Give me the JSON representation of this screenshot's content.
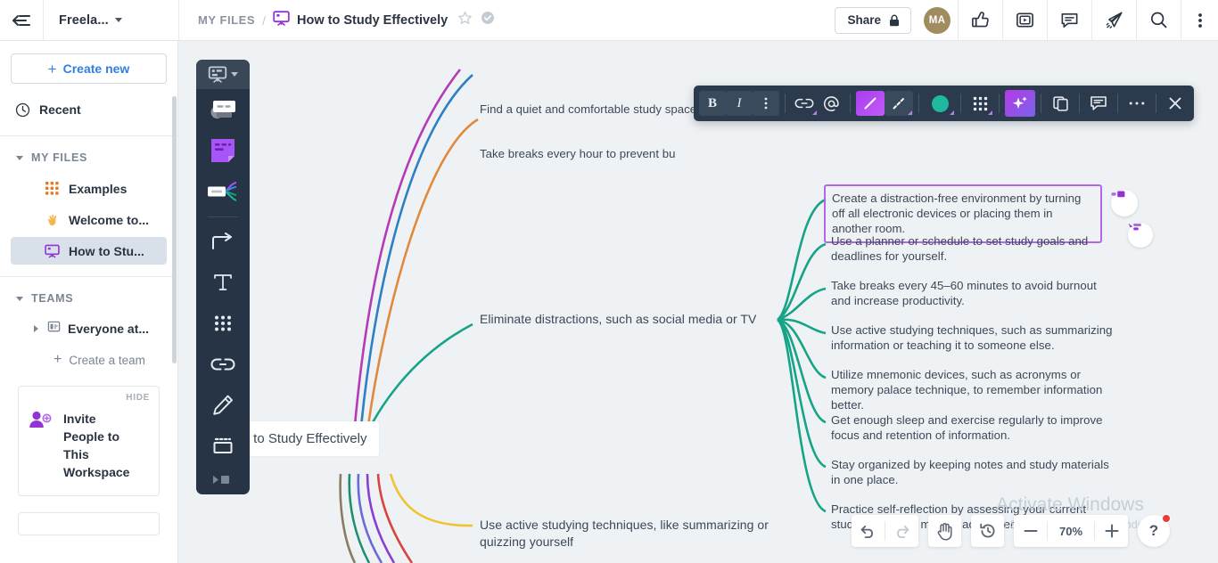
{
  "topbar": {
    "collapse_icon": "collapse-sidebar-icon",
    "workspace_name": "Freela...",
    "breadcrumb_root": "MY FILES",
    "breadcrumb_sep": "/",
    "board_title": "How to Study Effectively",
    "share_label": "Share",
    "avatar_initials": "MA",
    "icons": [
      "thumbs-up-icon",
      "presentation-play-icon",
      "comment-icon",
      "paper-plane-icon",
      "search-icon",
      "kebab-menu-icon"
    ]
  },
  "sidebar": {
    "create_new": "Create new",
    "recent": "Recent",
    "sections": [
      {
        "label": "MY FILES",
        "expanded": true
      },
      {
        "label": "TEAMS",
        "expanded": true
      }
    ],
    "files": [
      {
        "label": "Examples",
        "icon": "grid-orange-icon",
        "active": false
      },
      {
        "label": "Welcome to...",
        "icon": "waving-hand-icon",
        "active": false
      },
      {
        "label": "How to Stu...",
        "icon": "board-purple-icon",
        "active": true
      }
    ],
    "teams": [
      {
        "label": "Everyone at...",
        "icon": "org-building-icon"
      }
    ],
    "create_team": "Create a team",
    "invite_card": {
      "hide_label": "HIDE",
      "title": "Invite People to This Workspace",
      "icon": "add-person-icon"
    }
  },
  "vtoolbar": {
    "header_icon": "board-select-icon",
    "items": [
      {
        "name": "sticky-chat-tool",
        "label": "comment-bubbles-tool"
      },
      {
        "name": "note-tool",
        "label": "sticky-note-tool"
      },
      {
        "name": "mindmap-tool",
        "label": "mindmap-tool"
      },
      {
        "name": "arrow-tool",
        "label": "connector-arrow-tool"
      },
      {
        "name": "text-tool",
        "label": "text-tool"
      },
      {
        "name": "shapes-tool",
        "label": "shapes-grid-tool"
      },
      {
        "name": "link-tool",
        "label": "link-tool"
      },
      {
        "name": "pen-tool",
        "label": "pen-draw-tool"
      },
      {
        "name": "frame-tool",
        "label": "frame-tool"
      },
      {
        "name": "more-tool",
        "label": "more-tools"
      }
    ]
  },
  "format_toolbar": {
    "buttons": [
      {
        "name": "bold-button",
        "label": "B",
        "active": false
      },
      {
        "name": "italic-button",
        "label": "I",
        "active": false
      },
      {
        "name": "text-more-button",
        "label": "vertical-dots-icon",
        "active": false
      },
      {
        "name": "link-button",
        "label": "link-icon",
        "active": false
      },
      {
        "name": "mention-button",
        "label": "at-mention-icon",
        "active": false
      },
      {
        "name": "line-style-button",
        "label": "solid-line-icon",
        "active": true
      },
      {
        "name": "line-dash-button",
        "label": "dashed-line-icon",
        "active": true
      },
      {
        "name": "color-button",
        "label": "teal-color-swatch",
        "active": false
      },
      {
        "name": "layout-button",
        "label": "grid-layout-icon",
        "active": false
      },
      {
        "name": "ai-button",
        "label": "sparkle-ai-icon",
        "active": true
      },
      {
        "name": "duplicate-button",
        "label": "copy-icon",
        "active": false
      },
      {
        "name": "comment-button",
        "label": "comment-icon",
        "active": false
      },
      {
        "name": "more-button",
        "label": "ellipsis-icon",
        "active": false
      },
      {
        "name": "close-button",
        "label": "close-x-icon",
        "active": false
      }
    ],
    "accent_color": "#9b5de5",
    "teal_swatch": "#1fb8a0"
  },
  "mindmap": {
    "root": "How to Study Effectively",
    "left_branches": [
      {
        "text": "Find a quiet and comfortable study space",
        "color": "#2f7fc4"
      },
      {
        "text": "Take breaks every hour to prevent bu",
        "color": "#e08a3c"
      },
      {
        "text": "Eliminate distractions, such as social media or TV",
        "color": "#17a388"
      },
      {
        "text": "Use active studying techniques, like summarizing or quizzing yourself",
        "color": "#f0c330"
      }
    ],
    "selected_node": "Create a distraction-free environment by turning off all electronic devices or placing them in another room.",
    "sub_branches": [
      "Use a planner or schedule to set study goals and deadlines for yourself.",
      "Take breaks every 45–60 minutes to avoid burnout and increase productivity.",
      "Use active studying techniques, such as summarizing information or teaching it to someone else.",
      "Utilize mnemonic devices, such as acronyms or memory palace technique, to remember information better.",
      "Get enough sleep and exercise regularly to improve focus and retention of information.",
      "Stay organized by keeping notes and study materials in one place.",
      "Practice self-reflection by assessing your current study habits and making adjustments as necessary."
    ],
    "branch_colors": [
      "#b53ab5",
      "#2f7fc4",
      "#e08a3c",
      "#17a388",
      "#8a7c63",
      "#1f8f6f",
      "#6a6ad8",
      "#8b3fd0",
      "#d8453f",
      "#f0c330"
    ]
  },
  "bottom_controls": {
    "undo": "undo-icon",
    "redo": "redo-icon",
    "hand": "hand-pan-icon",
    "history": "history-icon",
    "zoom_out": "minus-icon",
    "zoom_value": "70%",
    "zoom_in": "plus-icon",
    "help": "?"
  },
  "watermark": {
    "line1": "Activate Windows",
    "line2": "Go to Settings to activate Windows."
  }
}
